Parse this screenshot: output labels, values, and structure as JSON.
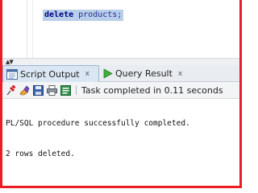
{
  "editor": {
    "keyword": "delete",
    "rest": " products;"
  },
  "splitter": {
    "arrows_icon": "collapse-expand-arrows"
  },
  "tabs": [
    {
      "label": "Script Output",
      "close": "x",
      "icon": "script-output-icon"
    },
    {
      "label": "Query Result",
      "close": "x",
      "icon": "run-triangle-icon"
    }
  ],
  "toolbar": {
    "icons": [
      "pin-icon",
      "eraser-icon",
      "save-icon",
      "print-icon",
      "export-icon"
    ],
    "status": "Task completed in 0.11 seconds"
  },
  "output": {
    "lines": [
      "PL/SQL procedure successfully completed.",
      "2 rows deleted."
    ]
  },
  "colors": {
    "border": "#ec1c24",
    "selection": "#b7cfe8",
    "keyword": "#00008b"
  }
}
